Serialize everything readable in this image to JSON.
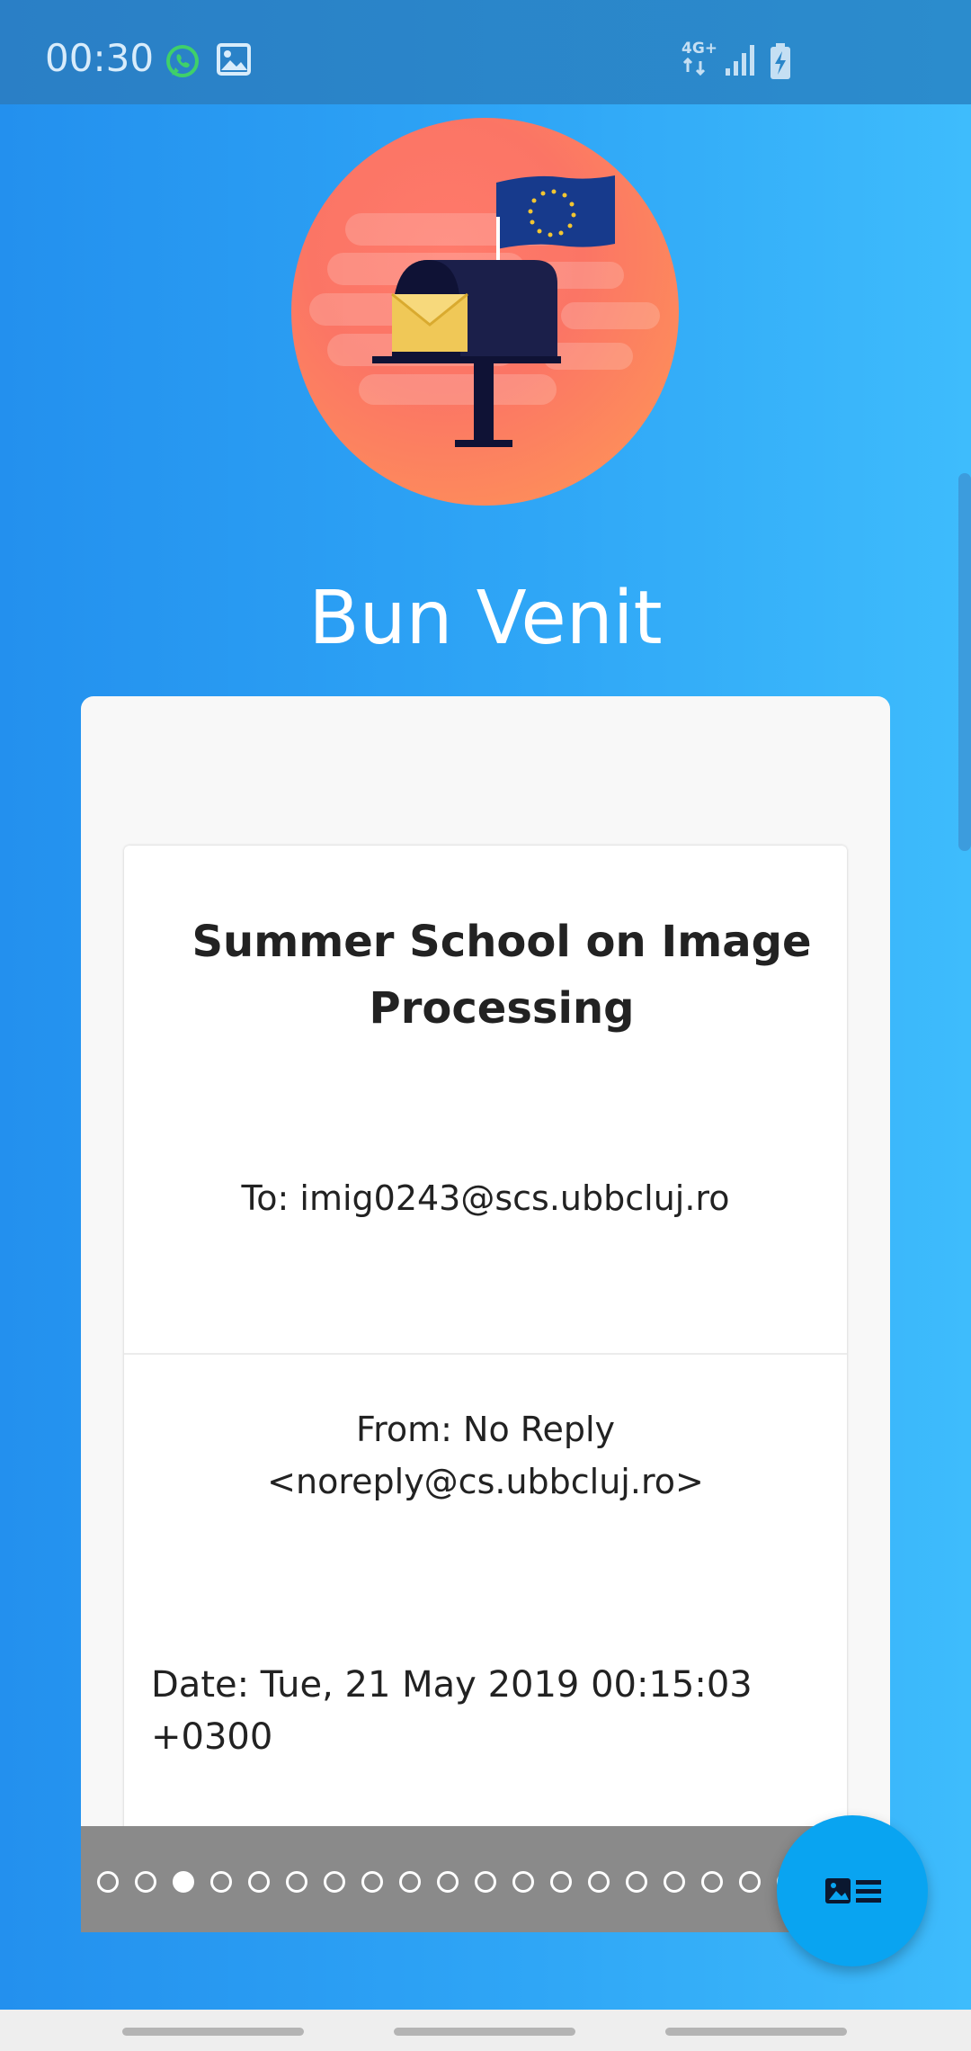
{
  "status_bar": {
    "time": "00:30",
    "network": "4G+",
    "icons": [
      "whatsapp-icon",
      "gallery-icon",
      "network-4g-icon",
      "signal-icon",
      "battery-charging-icon"
    ]
  },
  "welcome": {
    "title": "Bun Venit",
    "hero_icon": "mailbox-eu-flag-icon"
  },
  "email": {
    "subject": "Summer School on Image Processing",
    "to": "To: imig0243@scs.ubbcluj.ro",
    "from": "From: No Reply <noreply@cs.ubbcluj.ro>",
    "date": "Date: Tue, 21 May 2019 00:15:03 +0300"
  },
  "pager": {
    "visible_dots": 19,
    "active_index": 2
  },
  "fab": {
    "icon": "article-list-icon"
  },
  "colors": {
    "background_start": "#2390ee",
    "background_end": "#3ebcfc",
    "fab": "#09a4f1",
    "hero_start": "#ff7a6b",
    "hero_end": "#ff9a55",
    "pager_bar": "#8a8a8a"
  }
}
